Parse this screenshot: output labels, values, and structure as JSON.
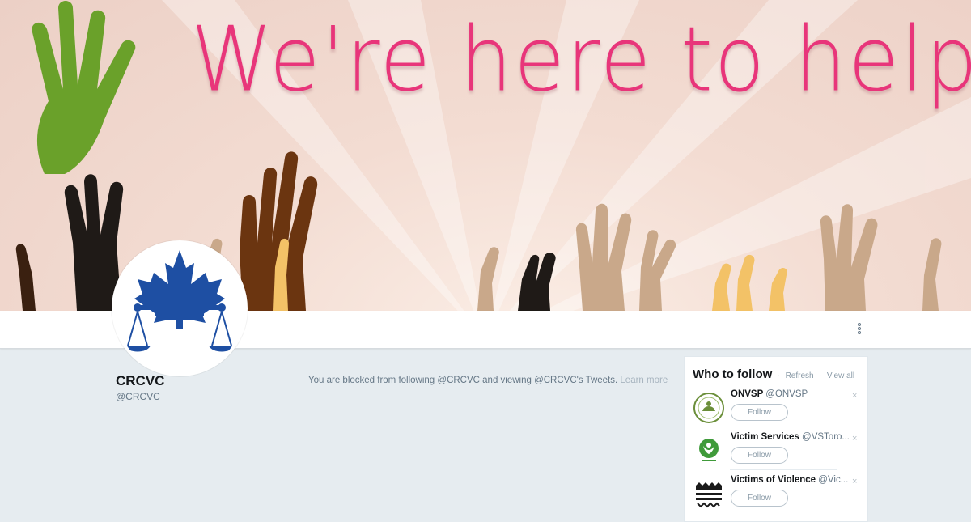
{
  "banner": {
    "headline": "We're here to help"
  },
  "profile": {
    "name": "CRCVC",
    "handle": "@CRCVC"
  },
  "blocked": {
    "message": "You are blocked from following @CRCVC and viewing @CRCVC's Tweets.",
    "learn_more": "Learn more"
  },
  "who_to_follow": {
    "title": "Who to follow",
    "sep1": "·",
    "refresh": "Refresh",
    "sep2": "·",
    "view_all": "View all",
    "close_glyph": "×",
    "suggestions": [
      {
        "name": "ONVSP",
        "handle": "@ONVSP",
        "button": "Follow",
        "avatar_icon": "onvsp-logo-icon"
      },
      {
        "name": "Victim Services",
        "handle": "@VSToro...",
        "button": "Follow",
        "avatar_icon": "victim-services-logo-icon"
      },
      {
        "name": "Victims of Violence",
        "handle": "@Vic...",
        "button": "Follow",
        "avatar_icon": "victims-of-violence-logo-icon"
      }
    ]
  },
  "colors": {
    "headline_pink": "#e8357a",
    "brand_blue": "#1e4fa3",
    "background": "#e6ecf0"
  }
}
